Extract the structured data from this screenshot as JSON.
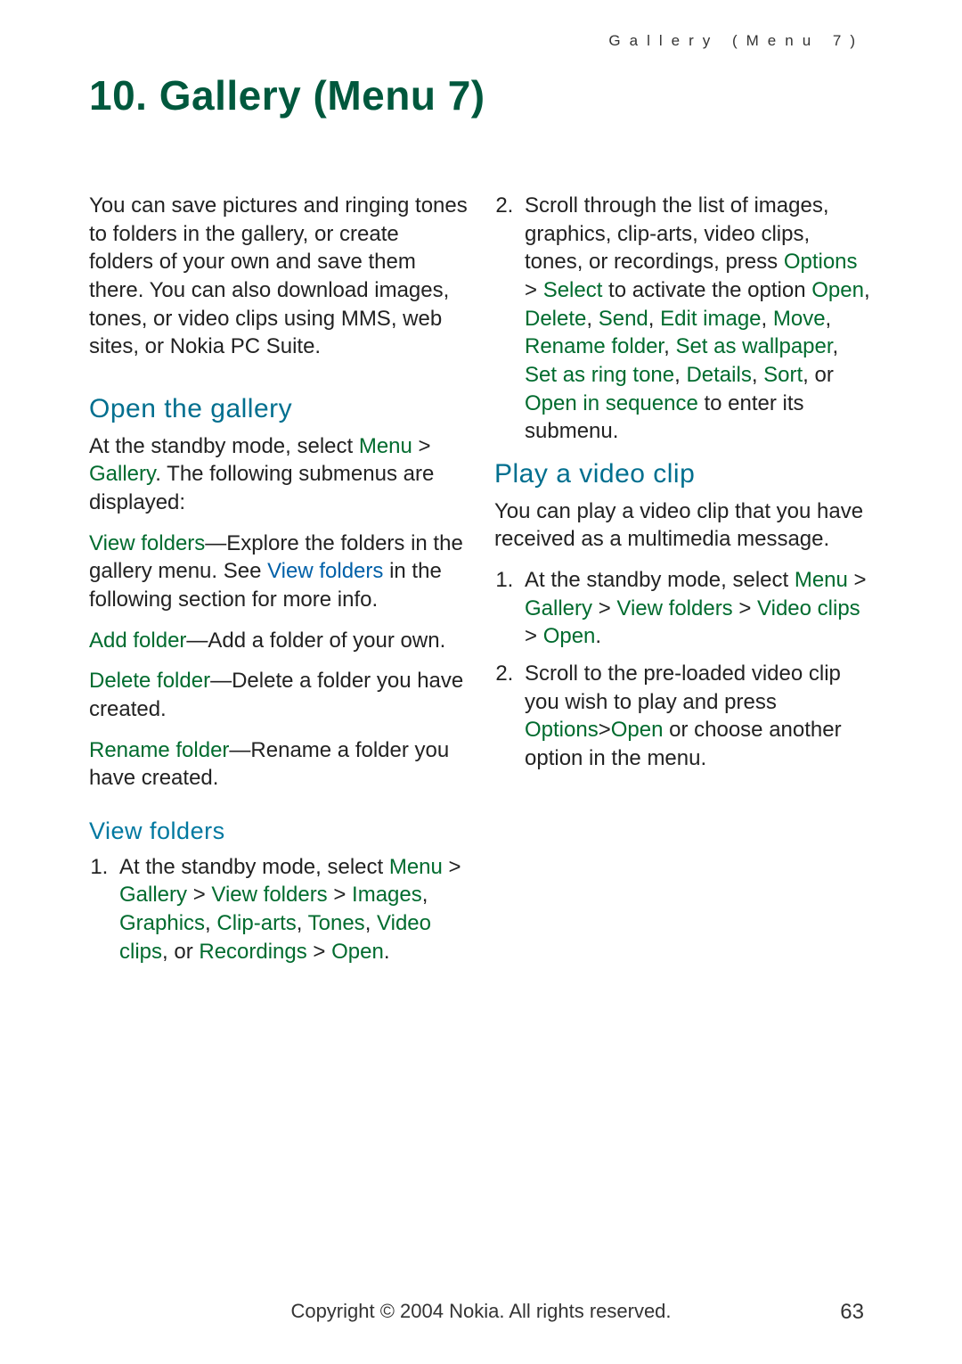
{
  "header": "Gallery (Menu 7)",
  "chapter_title": "10. Gallery (Menu 7)",
  "intro_para": "You can save pictures and ringing tones to folders in the gallery, or create folders of your own and save them there. You can also download images, tones, or video clips using MMS, web sites, or Nokia PC Suite.",
  "open_gallery": {
    "heading": "Open the gallery",
    "lead_a": "At the standby mode, select ",
    "lead_b_menu": "Menu",
    "lead_gt": " > ",
    "lead_gallery": "Gallery",
    "lead_tail": ". The following submenus are displayed:",
    "items": {
      "view_folders_lbl": "View folders",
      "view_folders_txt_a": "—Explore the folders in the gallery menu. See ",
      "view_folders_link": "View folders",
      "view_folders_txt_b": " in the following section for more info.",
      "add_folder_lbl": "Add folder",
      "add_folder_txt": "—Add a folder of your own.",
      "delete_folder_lbl": "Delete folder",
      "delete_folder_txt": "—Delete a folder you have created.",
      "rename_folder_lbl": "Rename folder",
      "rename_folder_txt": "—Rename a folder you have created."
    }
  },
  "view_folders": {
    "heading": "View folders",
    "step1_a": "At the standby mode, select ",
    "menu": "Menu",
    "gt": " > ",
    "gallery": "Gallery",
    "vf": "View folders",
    "images": "Images",
    "graphics": "Graphics",
    "cliparts": "Clip-arts",
    "tones": "Tones",
    "videoclips": "Video clips",
    "recordings": "Recordings",
    "open": "Open",
    "comma": ", ",
    "or": ", or ",
    "period": ".",
    "step2_a": "Scroll through the list of images, graphics, clip-arts, video clips, tones, or recordings, press ",
    "options": "Options",
    "select": "Select",
    "step2_b": " to activate the option ",
    "open2": "Open",
    "delete": "Delete",
    "send": "Send",
    "editimage": "Edit image",
    "move": "Move",
    "renamefolder": "Rename folder",
    "setwall": "Set as wallpaper",
    "setring": "Set as ring tone",
    "details": "Details",
    "sort": "Sort",
    "or2": ", or ",
    "openinseq": "Open in sequence",
    "step2_c": " to enter its submenu."
  },
  "play_video": {
    "heading": "Play a video clip",
    "intro": "You can play a video clip that you have received as a multimedia message.",
    "step1_a": "At the standby mode, select ",
    "menu": "Menu",
    "gt": " > ",
    "gallery": "Gallery",
    "vf": "View folders",
    "videoclips": "Video clips",
    "open": "Open",
    "period": ".",
    "step2_a": "Scroll to the pre-loaded video clip you wish to play and press ",
    "options": "Options",
    "open2": "Open",
    "step2_b": " or choose another option in the menu."
  },
  "footer": "Copyright © 2004 Nokia. All rights reserved.",
  "page_number": "63"
}
